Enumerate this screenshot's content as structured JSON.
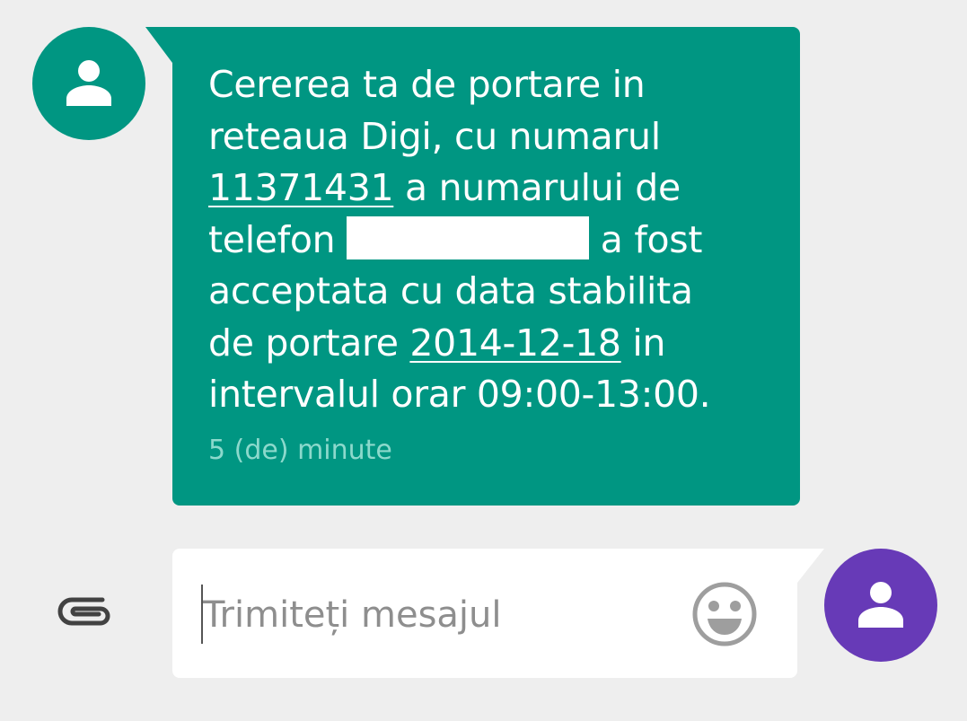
{
  "conversation": {
    "incoming_message": {
      "line1": "Cererea ta de portare in",
      "line2": "reteaua Digi, cu numarul",
      "portare_number": "11371431",
      "line3_rest": " a numarului de",
      "line4_start": "telefon ",
      "line4_rest": " a fost",
      "line5": "acceptata cu data stabilita",
      "line6_start": "de portare ",
      "portare_date": "2014-12-18",
      "line6_rest": " in",
      "line7": "intervalul orar 09:00-13:00.",
      "time": "5 (de) minute"
    }
  },
  "compose": {
    "placeholder": "Trimiteți mesajul",
    "value": ""
  },
  "icons": {
    "sender_avatar": "person-icon",
    "attach": "paperclip-icon",
    "emoji": "smiley-icon",
    "self_avatar": "person-icon"
  },
  "colors": {
    "bubble": "#009682",
    "self_avatar": "#673ab7",
    "background": "#eeeeee"
  }
}
